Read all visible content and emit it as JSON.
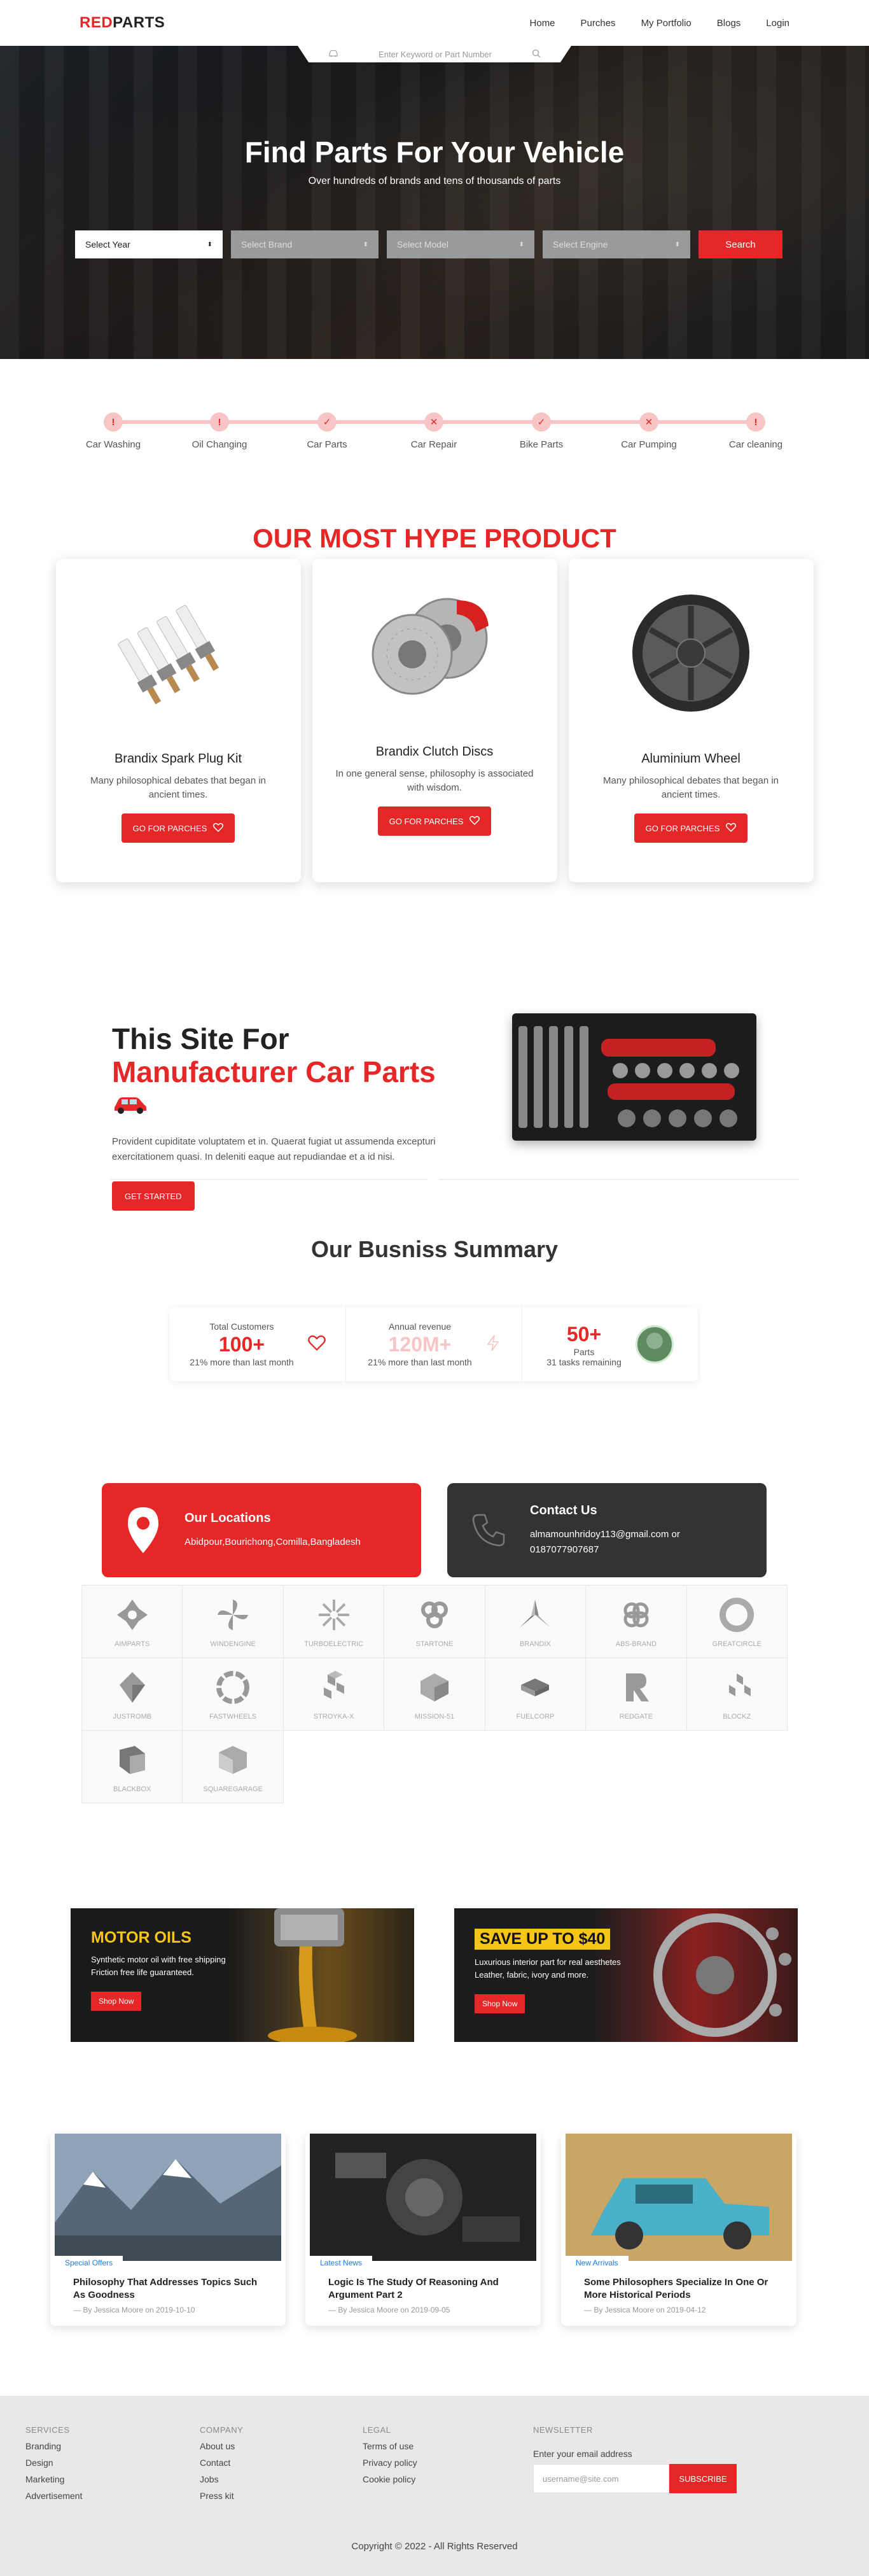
{
  "nav": {
    "logo_red": "RED",
    "logo_dark": "PARTS",
    "links": [
      "Home",
      "Purches",
      "My Portfolio",
      "Blogs",
      "Login"
    ]
  },
  "search_bar": {
    "placeholder": "Enter Keyword or Part Number"
  },
  "hero": {
    "title": "Find Parts For Your Vehicle",
    "subtitle": "Over hundreds of brands and tens of thousands of parts",
    "selects": [
      "Select Year",
      "Select Brand",
      "Select Model",
      "Select Engine"
    ],
    "search_button": "Search"
  },
  "steps": [
    {
      "label": "Car Washing",
      "icon": "!"
    },
    {
      "label": "Oil Changing",
      "icon": "!"
    },
    {
      "label": "Car Parts",
      "icon": "✓"
    },
    {
      "label": "Car Repair",
      "icon": "✕"
    },
    {
      "label": "Bike Parts",
      "icon": "✓"
    },
    {
      "label": "Car Pumping",
      "icon": "✕"
    },
    {
      "label": "Car cleaning",
      "icon": "!"
    }
  ],
  "products": {
    "title": "OUR MOST HYPE PRODUCT",
    "items": [
      {
        "name": "Brandix Spark Plug Kit",
        "desc": "Many philosophical debates that began in ancient times.",
        "button": "GO FOR PARCHES"
      },
      {
        "name": "Brandix Clutch Discs",
        "desc": "In one general sense, philosophy is associated with wisdom.",
        "button": "GO FOR PARCHES"
      },
      {
        "name": "Aluminium Wheel",
        "desc": "Many philosophical debates that began in ancient times.",
        "button": "GO FOR PARCHES"
      }
    ]
  },
  "manufacturer": {
    "line1": "This Site For",
    "line2": "Manufacturer Car Parts",
    "paragraph": "Provident cupiditate voluptatem et in. Quaerat fugiat ut assumenda excepturi exercitationem quasi. In deleniti eaque aut repudiandae et a id nisi.",
    "button": "GET STARTED"
  },
  "summary": {
    "title": "Our Busniss Summary",
    "items": [
      {
        "label": "Total Customers",
        "value": "100+",
        "sub": "21% more than last month"
      },
      {
        "label": "Annual revenue",
        "value": "120M+",
        "sub": "21% more than last month"
      },
      {
        "label": "Parts",
        "value": "50+",
        "sub": "31 tasks remaining"
      }
    ]
  },
  "contact": {
    "location_title": "Our Locations",
    "location_text": "Abidpour,Bourichong,Comilla,Bangladesh",
    "contact_title": "Contact Us",
    "contact_email": "almamounhridoy113@gmail.com or",
    "contact_phone": "0187077907687"
  },
  "brands": [
    "AIMPARTS",
    "WINDENGINE",
    "TURBOELECTRIC",
    "STARTONE",
    "BRANDIX",
    "ABS-BRAND",
    "GREATCIRCLE",
    "JUSTROMB",
    "FASTWHEELS",
    "STROYKA-X",
    "MISSION-51",
    "FUELCORP",
    "REDGATE",
    "BLOCKZ",
    "BLACKBOX",
    "SQUAREGARAGE"
  ],
  "promos": [
    {
      "title": "MOTOR OILS",
      "line1": "Synthetic motor oil with free shipping",
      "line2": "Friction free life guaranteed.",
      "button": "Shop Now"
    },
    {
      "title": "SAVE UP TO $40",
      "line1": "Luxurious interior part for real aesthetes",
      "line2": "Leather, fabric, ivory and more.",
      "button": "Shop Now"
    }
  ],
  "blogs": [
    {
      "tag": "Special Offers",
      "title": "Philosophy That Addresses Topics Such As Goodness",
      "meta": "By Jessica Moore on 2019-10-10"
    },
    {
      "tag": "Latest News",
      "title": "Logic Is The Study Of Reasoning And Argument Part 2",
      "meta": "By Jessica Moore on 2019-09-05"
    },
    {
      "tag": "New Arrivals",
      "title": "Some Philosophers Specialize In One Or More Historical Periods",
      "meta": "By Jessica Moore on 2019-04-12"
    }
  ],
  "footer": {
    "services_head": "SERVICES",
    "services": [
      "Branding",
      "Design",
      "Marketing",
      "Advertisement"
    ],
    "company_head": "COMPANY",
    "company": [
      "About us",
      "Contact",
      "Jobs",
      "Press kit"
    ],
    "legal_head": "LEGAL",
    "legal": [
      "Terms of use",
      "Privacy policy",
      "Cookie policy"
    ],
    "newsletter_head": "NEWSLETTER",
    "newsletter_label": "Enter your email address",
    "newsletter_placeholder": "username@site.com",
    "newsletter_button": "SUBSCRIBE",
    "copyright": "Copyright © 2022 - All Rights Reserved"
  },
  "colors": {
    "accent": "#e52727",
    "accent_light": "#f7c5c5",
    "dark": "#333333",
    "promo_yellow": "#f5c518",
    "tag_blue": "#1e7be6"
  }
}
